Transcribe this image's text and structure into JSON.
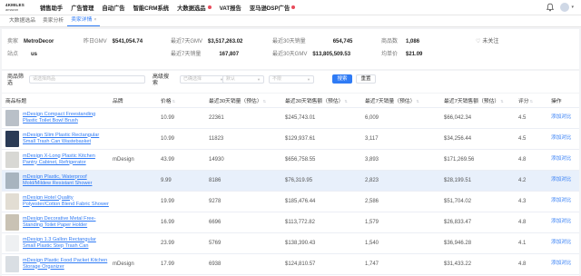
{
  "topnav": {
    "logo_line1": "4KMILES",
    "logo_line2": "amazon",
    "items": [
      {
        "label": "销售助手",
        "dot": false
      },
      {
        "label": "广告管理",
        "dot": false
      },
      {
        "label": "自动广告",
        "dot": false
      },
      {
        "label": "智能CRM系统",
        "dot": false
      },
      {
        "label": "大数据选品",
        "dot": true
      },
      {
        "label": "VAT报告",
        "dot": false
      },
      {
        "label": "亚马逊DSP广告",
        "dot": true
      }
    ]
  },
  "tabs": [
    {
      "label": "大数据选品",
      "active": false
    },
    {
      "label": "卖家分析",
      "active": false
    },
    {
      "label": "卖家详情",
      "active": true
    }
  ],
  "info": {
    "seller_label": "卖家",
    "seller_value": "MetroDecor",
    "site_label": "站点",
    "site_value": "us",
    "gmv_label": "昨日GMV",
    "gmv_value": "$541,054.74",
    "gmv7_label": "最近7天GMV",
    "gmv7_value": "$3,517,263.02",
    "gmv30_label": "最近30天GMV",
    "gmv30_value": "$13,805,509.53",
    "sales30_label": "最近30天销量",
    "sales30_value": "654,745",
    "sales7_label": "最近7天销量",
    "sales7_value": "167,807",
    "products_label": "商品数",
    "products_value": "1,086",
    "price_label": "均单价",
    "price_value": "$21.09",
    "follow_label": "未关注"
  },
  "filter": {
    "product_filter_label": "商品筛选",
    "product_filter_placeholder": "请选择商品",
    "advanced_label": "高级搜索",
    "select1": "已确选择",
    "select2": "默认",
    "select3": "不限",
    "search_button": "搜索",
    "reset_button": "重置"
  },
  "table": {
    "headers": [
      "商品标题",
      "品牌",
      "价格",
      "最近30天销量（预估）",
      "最近30天销售额（预估）",
      "最近7天销量（预估）",
      "最近7天销售额（预估）",
      "评分",
      "操作"
    ],
    "action_label": "添加对比",
    "rows": [
      {
        "title": "mDesign Compact Freestanding Plastic Toilet Bowl Brush",
        "brand": "",
        "price": "10.99",
        "sales30": "22361",
        "revenue30": "$245,743.01",
        "sales7": "6,009",
        "revenue7": "$66,042.34",
        "rating": "4.5",
        "thumb": "#b9c0c8"
      },
      {
        "title": "mDesign Slim Plastic Rectangular Small Trash Can Wastebasket",
        "brand": "",
        "price": "10.99",
        "sales30": "11823",
        "revenue30": "$129,937.61",
        "sales7": "3,117",
        "revenue7": "$34,256.44",
        "rating": "4.5",
        "thumb": "#2a3a55"
      },
      {
        "title": "mDesign X-Long Plastic Kitchen Pantry Cabinet, Refrigerator",
        "brand": "mDesign",
        "price": "43.99",
        "sales30": "14930",
        "revenue30": "$656,758.55",
        "sales7": "3,893",
        "revenue7": "$171,269.56",
        "rating": "4.8",
        "thumb": "#d8d8d4"
      },
      {
        "title": "mDesign Plastic, Waterproof Mold/Mildew Resistant Shower",
        "brand": "",
        "price": "9.99",
        "sales30": "8186",
        "revenue30": "$76,319.95",
        "sales7": "2,823",
        "revenue7": "$28,199.51",
        "rating": "4.2",
        "thumb": "#a8b4bf",
        "highlight": true
      },
      {
        "title": "mDesign Hotel Quality Polyester/Cotton Blend Fabric Shower",
        "brand": "",
        "price": "19.99",
        "sales30": "9278",
        "revenue30": "$185,476.44",
        "sales7": "2,586",
        "revenue7": "$51,704.02",
        "rating": "4.3",
        "thumb": "#e2ddd3"
      },
      {
        "title": "mDesign Decorative Metal Free-Standing Toilet Paper Holder",
        "brand": "",
        "price": "16.99",
        "sales30": "6696",
        "revenue30": "$113,772.82",
        "sales7": "1,579",
        "revenue7": "$26,833.47",
        "rating": "4.8",
        "thumb": "#c9c2b4"
      },
      {
        "title": "mDesign 1.3 Gallon Rectangular Small Plastic Step Trash Can",
        "brand": "",
        "price": "23.99",
        "sales30": "5769",
        "revenue30": "$138,390.43",
        "sales7": "1,540",
        "revenue7": "$36,946.28",
        "rating": "4.1",
        "thumb": "#eef0f2"
      },
      {
        "title": "mDesign Plastic Food Packet Kitchen Storage Organizer",
        "brand": "mDesign",
        "price": "17.99",
        "sales30": "6938",
        "revenue30": "$124,810.57",
        "sales7": "1,747",
        "revenue7": "$31,433.22",
        "rating": "4.8",
        "thumb": "#d9dee3"
      }
    ]
  }
}
